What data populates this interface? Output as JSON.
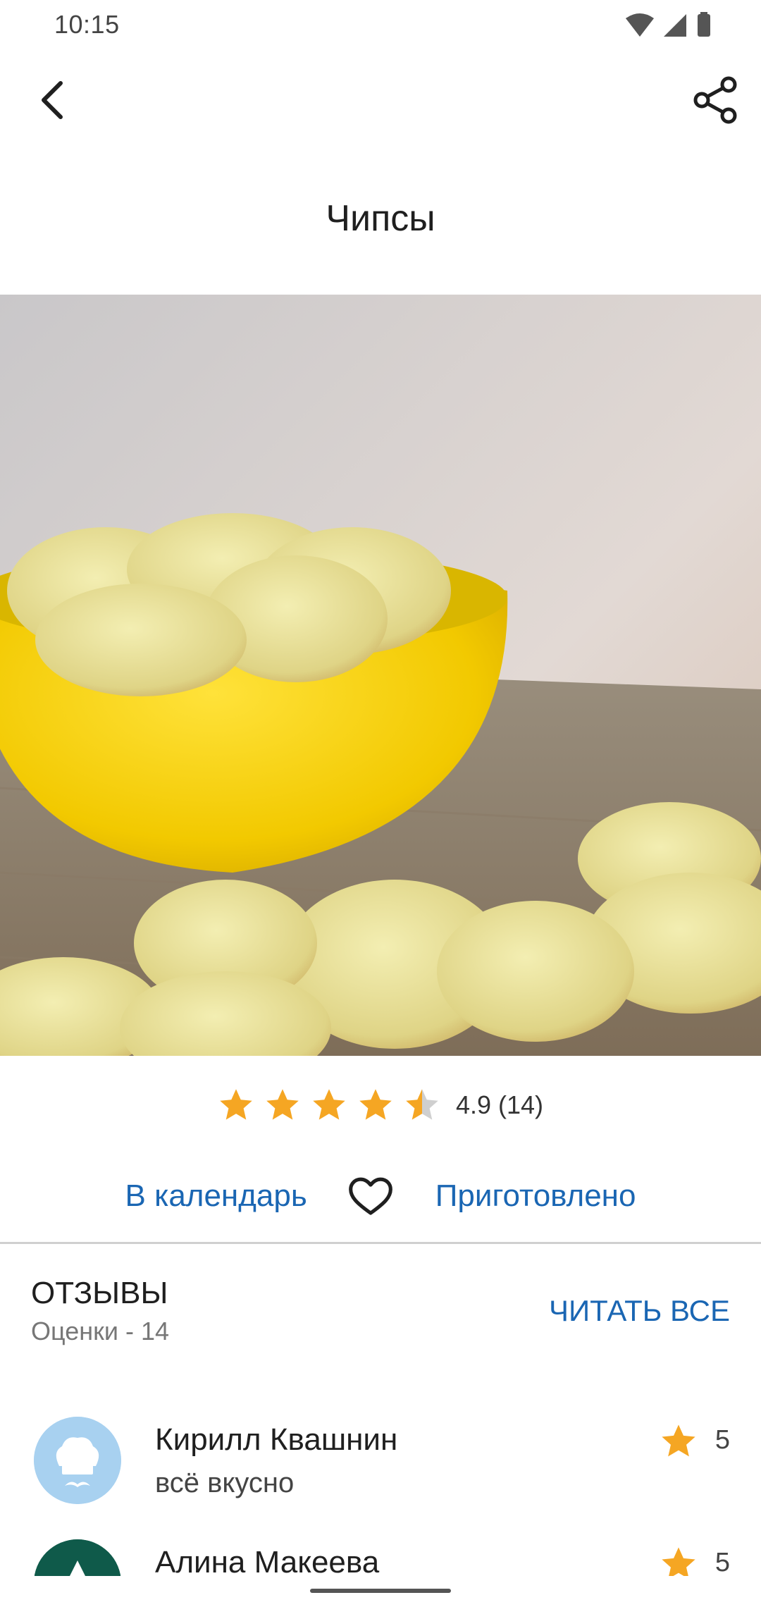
{
  "status": {
    "time": "10:15",
    "icons": [
      "wifi-icon",
      "signal-icon",
      "battery-icon"
    ]
  },
  "toolbar": {
    "back_icon": "back-arrow-icon",
    "share_icon": "share-icon"
  },
  "recipe": {
    "title": "Чипсы"
  },
  "rating": {
    "value": 4.9,
    "stars_filled": 4.5,
    "text": "4.9 (14)"
  },
  "actions": {
    "calendar_label": "В календарь",
    "favorite_icon": "heart-icon",
    "cooked_label": "Приготовлено"
  },
  "reviews": {
    "title": "ОТЗЫВЫ",
    "subtitle": "Оценки - 14",
    "read_all_label": "ЧИТАТЬ ВСЕ",
    "items": [
      {
        "name": "Кирилл Квашнин",
        "text": "всё вкусно",
        "rating": "5",
        "avatar": "chef-avatar-icon"
      },
      {
        "name": "Алина Макеева",
        "text": "",
        "rating": "5",
        "avatar": "letter-avatar"
      }
    ]
  },
  "colors": {
    "accent": "#1a66b3",
    "star": "#f5a623",
    "divider": "#d0d0d0",
    "avatar_bg": "#a8d1f0",
    "avatar2_bg": "#0f5a4a"
  }
}
